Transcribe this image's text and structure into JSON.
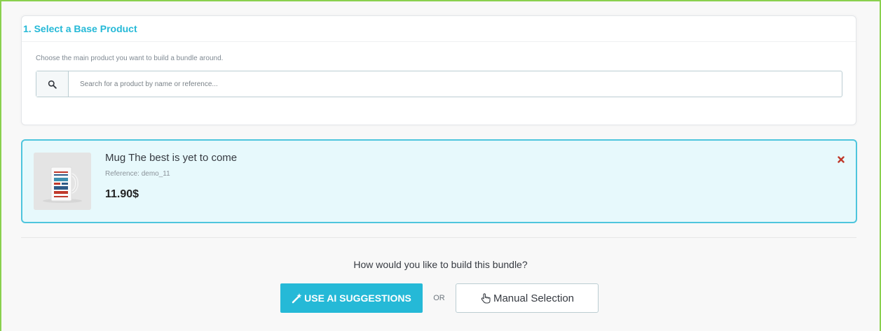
{
  "panel": {
    "title": "1. Select a Base Product",
    "help_text": "Choose the main product you want to build a bundle around.",
    "search": {
      "placeholder": "Search for a product by name or reference...",
      "value": ""
    }
  },
  "selected_product": {
    "name": "Mug The best is yet to come",
    "reference": "Reference: demo_11",
    "price": "11.90$",
    "image_icon": "mug-image"
  },
  "build": {
    "question": "How would you like to build this bundle?",
    "ai_button_label": "USE AI SUGGESTIONS",
    "or_label": "OR",
    "manual_button_label": "Manual Selection"
  },
  "colors": {
    "accent": "#25b9d7",
    "selected_bg": "#e7f9fc",
    "selected_border": "#4ec5dd",
    "remove": "#c0392b",
    "frame_border": "#8ad04e"
  }
}
